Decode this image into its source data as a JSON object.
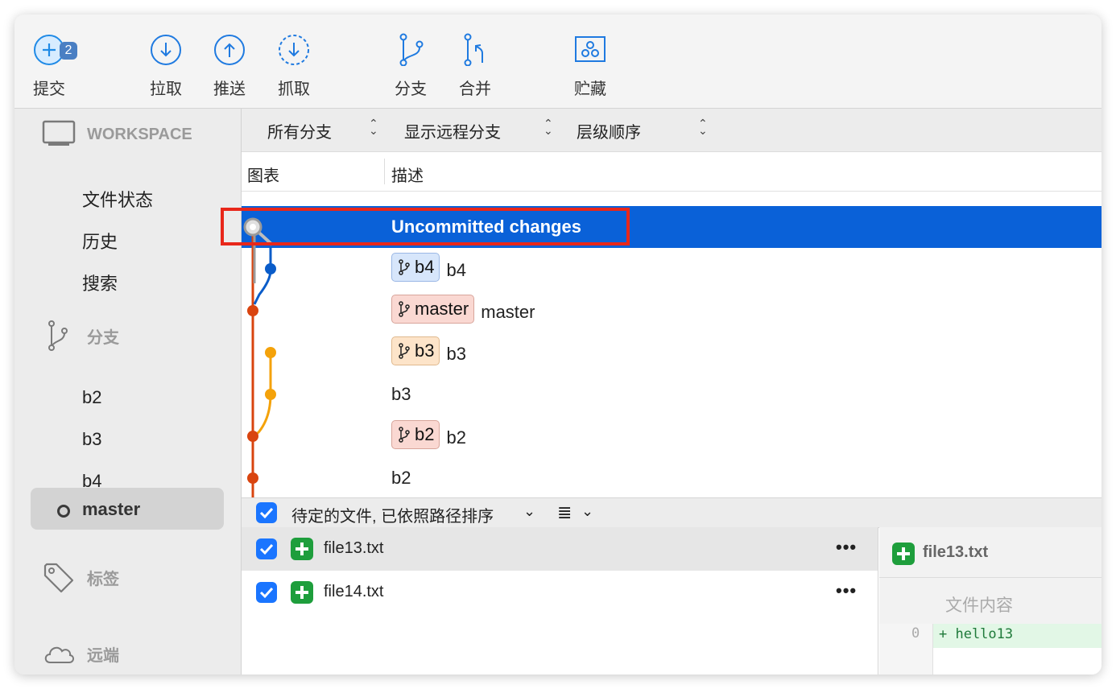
{
  "toolbar": {
    "commit_label": "提交",
    "commit_badge": "2",
    "pull_label": "拉取",
    "push_label": "推送",
    "fetch_label": "抓取",
    "branch_label": "分支",
    "merge_label": "合并",
    "stash_label": "贮藏"
  },
  "sidebar": {
    "workspace_title": "WORKSPACE",
    "workspace_items": [
      "文件状态",
      "历史",
      "搜索"
    ],
    "branches_title": "分支",
    "branches": [
      "b2",
      "b3",
      "b4"
    ],
    "current_branch": "master",
    "tags_title": "标签",
    "remotes_title": "远端"
  },
  "filters": {
    "branch_filter": "所有分支",
    "remote_filter": "显示远程分支",
    "order_filter": "层级顺序"
  },
  "columns": {
    "graph": "图表",
    "description": "描述"
  },
  "commits": [
    {
      "description": "Uncommitted changes",
      "tag": "",
      "selected": true
    },
    {
      "description": "b4",
      "tag": "b4"
    },
    {
      "description": "master",
      "tag": "master"
    },
    {
      "description": "b3",
      "tag": "b3"
    },
    {
      "description": "b3",
      "tag": ""
    },
    {
      "description": "b2",
      "tag": "b2"
    },
    {
      "description": "b2",
      "tag": ""
    }
  ],
  "graph_colors": {
    "orange_red": "#d9440f",
    "blue": "#0a5cc9",
    "amber": "#f4a20a",
    "gray": "#9a9a9a"
  },
  "staging": {
    "title": "待定的文件, 已依照路径排序",
    "files": [
      "file13.txt",
      "file14.txt"
    ]
  },
  "diff": {
    "file": "file13.txt",
    "section": "文件内容",
    "line_number": "0",
    "line": "+ hello13"
  },
  "colors": {
    "selection": "#0a61d8",
    "highlight": "#e8271a",
    "added": "#1e9e3c"
  }
}
